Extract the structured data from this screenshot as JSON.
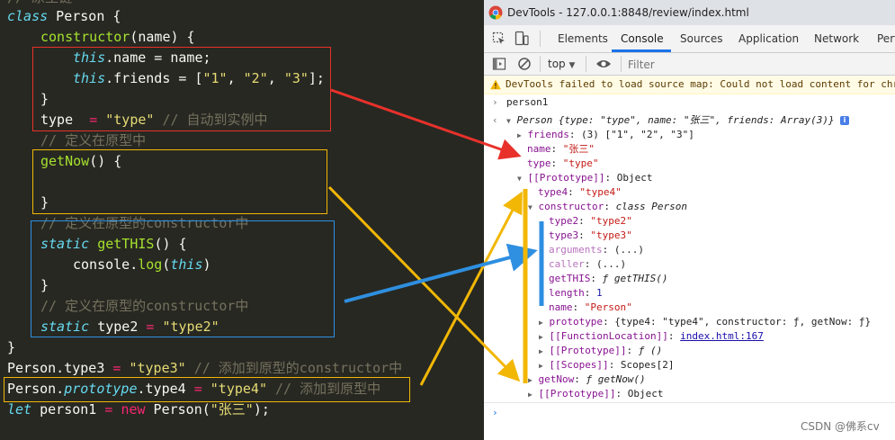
{
  "editor": {
    "top_comment": "// 原型链",
    "lines": {
      "l1": [
        "class",
        " Person {"
      ],
      "l2": [
        "constructor",
        "(name) {"
      ],
      "l3": [
        "this",
        ".name = name;"
      ],
      "l4": [
        "this",
        ".friends = [",
        "\"1\"",
        ", ",
        "\"2\"",
        ", ",
        "\"3\"",
        "];"
      ],
      "l5": "}",
      "l6": [
        "type  ",
        "= ",
        "\"type\"",
        " // 自动到实例中"
      ],
      "l7": "// 定义在原型中",
      "l8": [
        "getNow",
        "() {"
      ],
      "l9": "}",
      "l10": "// 定义在原型的constructor中",
      "l11": [
        "static",
        " ",
        "getTHIS",
        "() {"
      ],
      "l12": [
        "console.",
        "log",
        "(",
        "this",
        ")"
      ],
      "l13": "}",
      "l14": "// 定义在原型的constructor中",
      "l15": [
        "static",
        " type2 ",
        "= ",
        "\"type2\""
      ],
      "l16": "}",
      "l17": [
        "Person.type3 ",
        "= ",
        "\"type3\"",
        " // 添加到原型的constructor中"
      ],
      "l18": [
        "Person.",
        "prototype",
        ".type4 ",
        "= ",
        "\"type4\"",
        " // 添加到原型中"
      ],
      "l19": [
        "let",
        " person1 ",
        "= ",
        "new",
        " Person(",
        "\"张三\"",
        ");"
      ]
    }
  },
  "devtools": {
    "window_title": "DevTools - 127.0.0.1:8848/review/index.html",
    "tabs": [
      "Elements",
      "Console",
      "Sources",
      "Application",
      "Network",
      "Perf"
    ],
    "active_tab": "Console",
    "context": "top",
    "filter_placeholder": "Filter",
    "warning": "DevTools failed to load source map: Could not load content for chr",
    "input": "person1",
    "tree": {
      "r1_a": "Person ",
      "r1_b": "{type: \"type\", name: \"张三\", friends: Array(3)}",
      "r2_k": "friends",
      "r2_v": ": (3) [\"1\", \"2\", \"3\"]",
      "r3_k": "name",
      "r3_v": "\"张三\"",
      "r4_k": "type",
      "r4_v": "\"type\"",
      "r5_k": "[[Prototype]]",
      "r5_v": ": Object",
      "r6_k": "type4",
      "r6_v": "\"type4\"",
      "r7_k": "constructor",
      "r7_v": "class Person",
      "r8_k": "type2",
      "r8_v": "\"type2\"",
      "r9_k": "type3",
      "r9_v": "\"type3\"",
      "r10_k": "arguments",
      "r10_v": ": (...)",
      "r11_k": "caller",
      "r11_v": ": (...)",
      "r12_k": "getTHIS",
      "r12_v": "ƒ getTHIS()",
      "r13_k": "length",
      "r13_v": "1",
      "r14_k": "name",
      "r14_v": "\"Person\"",
      "r15_k": "prototype",
      "r15_v": ": {type4: \"type4\", constructor: ƒ, getNow: ƒ}",
      "r16_k": "[[FunctionLocation]]",
      "r16_v": "index.html:167",
      "r17_k": "[[Prototype]]",
      "r17_v": "ƒ ()",
      "r18_k": "[[Scopes]]",
      "r18_v": ": Scopes[2]",
      "r19_k": "getNow",
      "r19_v": "ƒ getNow()",
      "r20_k": "[[Prototype]]",
      "r20_v": ": Object"
    }
  },
  "watermark": "CSDN @佛系cv",
  "colors": {
    "red_annotation": "#e8312b",
    "yellow_annotation": "#f2b705",
    "blue_annotation": "#2f8fe0"
  }
}
